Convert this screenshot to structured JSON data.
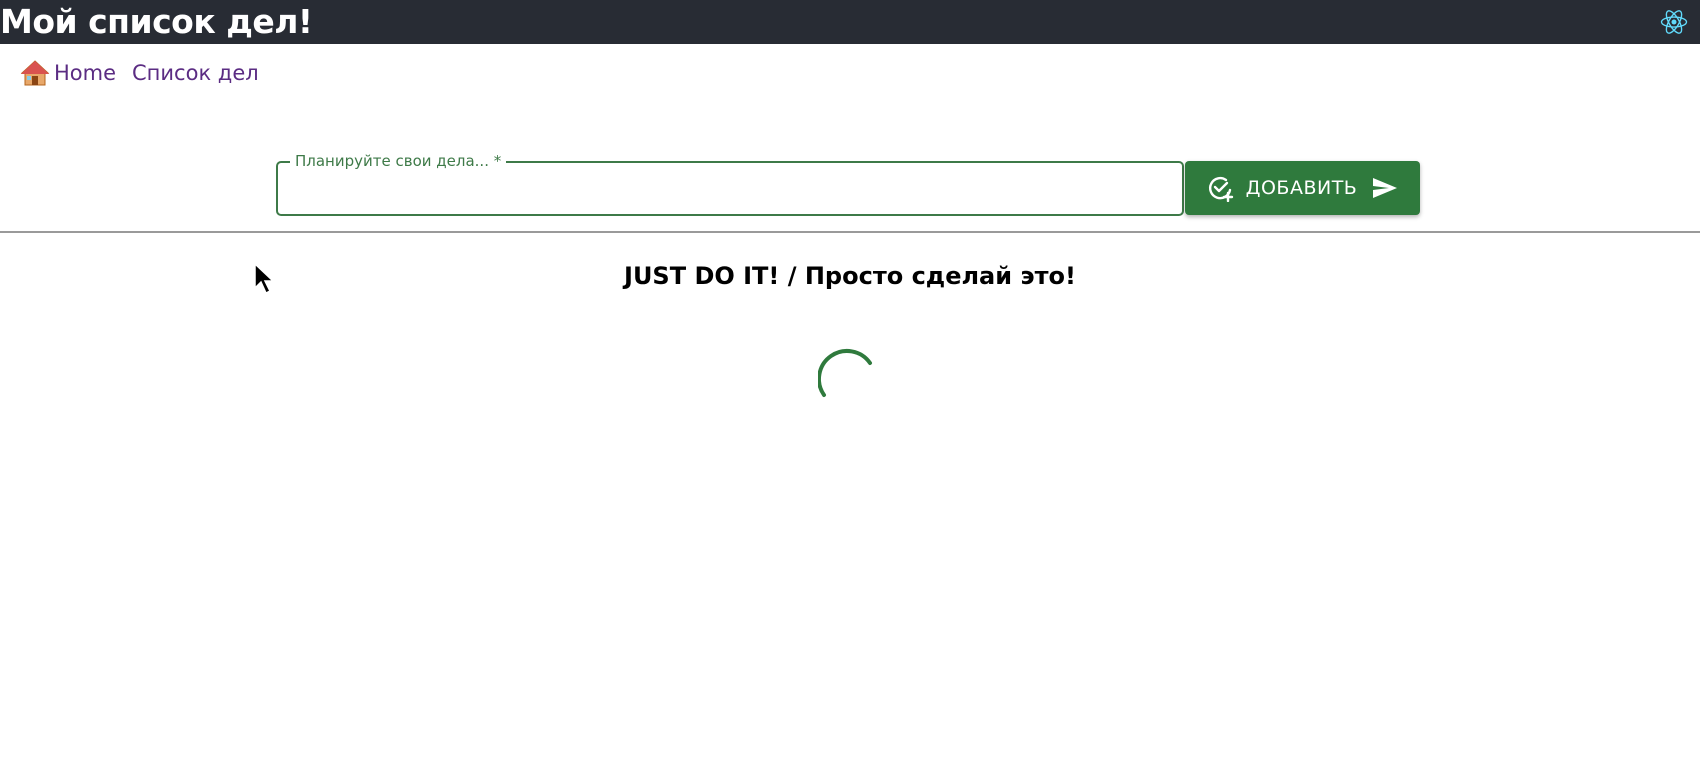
{
  "header": {
    "title": "Мой список дел!",
    "logo_icon": "react-logo-icon"
  },
  "nav": {
    "home_icon": "house-icon",
    "items": [
      {
        "label": "Home"
      },
      {
        "label": "Список дел"
      }
    ]
  },
  "form": {
    "input_label": "Планируйте свои дела... *",
    "input_value": "",
    "button_label": "ДОБАВИТЬ",
    "button_left_icon": "add-task-icon",
    "button_right_icon": "send-icon"
  },
  "main": {
    "heading": "JUST DO IT! / Просто сделай это!",
    "loading_indicator": "spinner-icon"
  },
  "colors": {
    "topbar_bg": "#282c34",
    "accent_green": "#2f7a3d",
    "link_purple": "#5b2c83"
  }
}
